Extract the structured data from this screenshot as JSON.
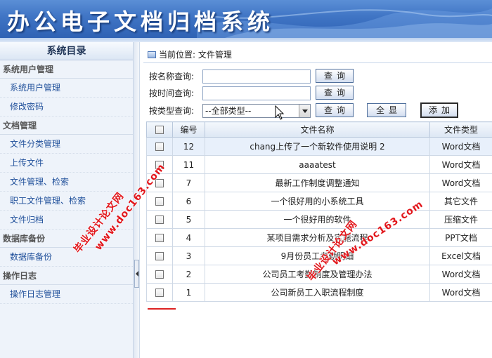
{
  "app": {
    "title": "办公电子文档归档系统"
  },
  "sidebar": {
    "title": "系统目录",
    "sections": [
      {
        "label": "系统用户管理",
        "items": [
          "系统用户管理",
          "修改密码"
        ]
      },
      {
        "label": "文档管理",
        "items": [
          "文件分类管理",
          "上传文件",
          "文件管理、检索",
          "职工文件管理、检索",
          "文件归档"
        ]
      },
      {
        "label": "数据库备份",
        "items": [
          "数据库备份"
        ]
      },
      {
        "label": "操作日志",
        "items": [
          "操作日志管理"
        ]
      }
    ]
  },
  "breadcrumb": {
    "prefix": "当前位置:",
    "page": "文件管理"
  },
  "search": {
    "by_name_label": "按名称查询:",
    "by_time_label": "按时间查询:",
    "by_type_label": "按类型查询:",
    "type_selected": "--全部类型--",
    "query_button": "查询",
    "show_all_button": "全显",
    "add_button": "添加"
  },
  "table": {
    "headers": [
      "",
      "编号",
      "文件名称",
      "文件类型"
    ],
    "rows": [
      {
        "id": "12",
        "name": "chang上传了一个新软件使用说明 2",
        "type": "Word文档"
      },
      {
        "id": "11",
        "name": "aaaatest",
        "type": "Word文档"
      },
      {
        "id": "7",
        "name": "最新工作制度调整通知",
        "type": "Word文档"
      },
      {
        "id": "6",
        "name": "一个很好用的小系统工具",
        "type": "其它文件"
      },
      {
        "id": "5",
        "name": "一个很好用的软件",
        "type": "压缩文件"
      },
      {
        "id": "4",
        "name": "某项目需求分析及实施流程",
        "type": "PPT文档"
      },
      {
        "id": "3",
        "name": "9月份员工考勤明细",
        "type": "Excel文档"
      },
      {
        "id": "2",
        "name": "公司员工考勤制度及管理办法",
        "type": "Word文档"
      },
      {
        "id": "1",
        "name": "公司新员工入职流程制度",
        "type": "Word文档"
      }
    ]
  },
  "watermarks": [
    "毕业设计论文网",
    "www.doc163.com"
  ],
  "colors": {
    "header": "#3f74c4",
    "watermark": "#e2161b",
    "link": "#1f4f9a"
  }
}
